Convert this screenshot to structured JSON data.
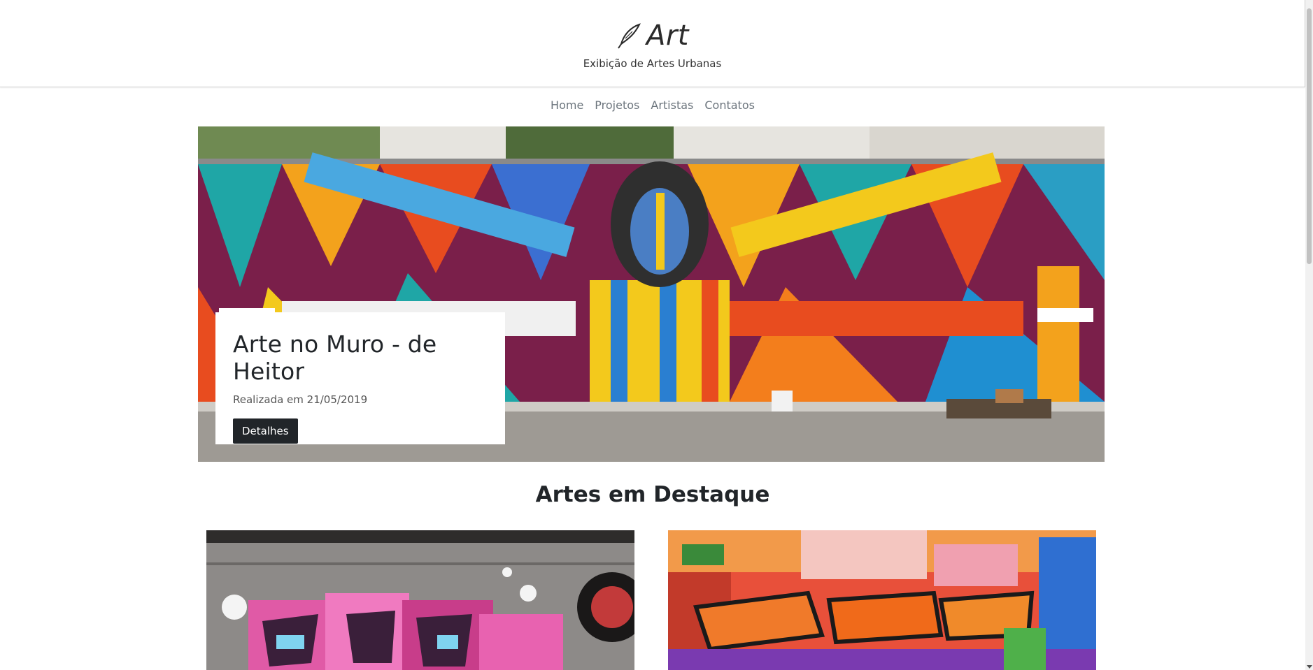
{
  "header": {
    "brand": "Art",
    "tagline": "Exibição de Artes Urbanas"
  },
  "nav": {
    "items": [
      "Home",
      "Projetos",
      "Artistas",
      "Contatos"
    ]
  },
  "hero": {
    "title": "Arte no Muro - de Heitor",
    "date": "Realizada em 21/05/2019",
    "button": "Detalhes"
  },
  "featured": {
    "title": "Artes em Destaque"
  }
}
